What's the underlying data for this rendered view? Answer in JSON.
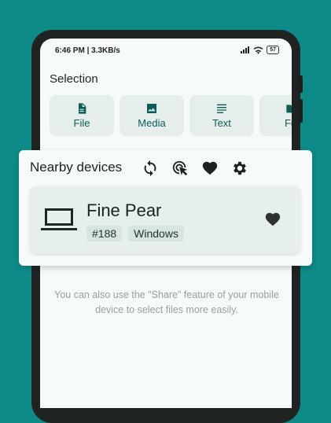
{
  "status_bar": {
    "time_speed": "6:46 PM | 3.3KB/s",
    "battery": "57"
  },
  "selection": {
    "title": "Selection",
    "tiles": [
      {
        "label": "File",
        "icon": "file-icon"
      },
      {
        "label": "Media",
        "icon": "image-icon"
      },
      {
        "label": "Text",
        "icon": "text-icon"
      },
      {
        "label": "Fol",
        "icon": "folder-icon"
      }
    ]
  },
  "nearby": {
    "title": "Nearby devices",
    "actions": [
      "refresh-icon",
      "scan-target-icon",
      "favorites-heart-icon",
      "settings-gear-icon"
    ],
    "device": {
      "name": "Fine Pear",
      "id_badge": "#188",
      "os_badge": "Windows",
      "icon": "laptop-icon"
    }
  },
  "hint": "You can also use the \"Share\" feature of your mobile device to select files more easily.",
  "colors": {
    "background": "#0e8b88",
    "accent": "#0c5d56",
    "tile": "#e6eeec"
  }
}
